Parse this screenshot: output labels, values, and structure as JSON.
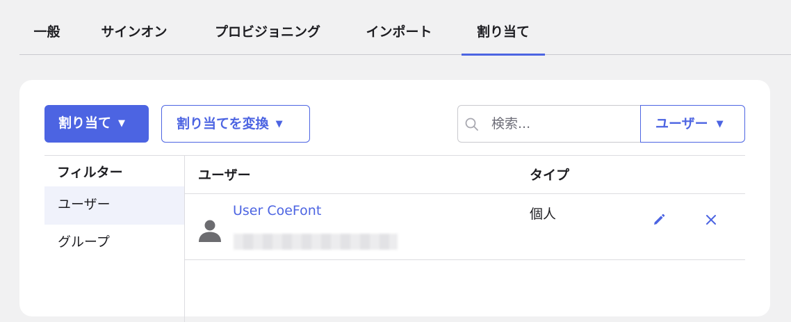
{
  "tabs": [
    {
      "label": "一般"
    },
    {
      "label": "サインオン"
    },
    {
      "label": "プロビジョニング"
    },
    {
      "label": "インポート"
    },
    {
      "label": "割り当て",
      "active": true
    }
  ],
  "toolbar": {
    "assign_label": "割り当て",
    "convert_label": "割り当てを変換",
    "caret": "▼",
    "search_placeholder": "検索...",
    "type_select_value": "ユーザー"
  },
  "filter": {
    "title": "フィルター",
    "items": [
      {
        "label": "ユーザー",
        "selected": true
      },
      {
        "label": "グループ",
        "selected": false
      }
    ]
  },
  "table": {
    "columns": {
      "user": "ユーザー",
      "type": "タイプ"
    },
    "rows": [
      {
        "name": "User CoeFont",
        "type": "個人",
        "avatar_icon": "person-icon"
      }
    ]
  },
  "colors": {
    "accent": "#4c64e2",
    "background": "#f1f1f2",
    "card": "#ffffff",
    "filter_selected": "#f0f2fb"
  }
}
